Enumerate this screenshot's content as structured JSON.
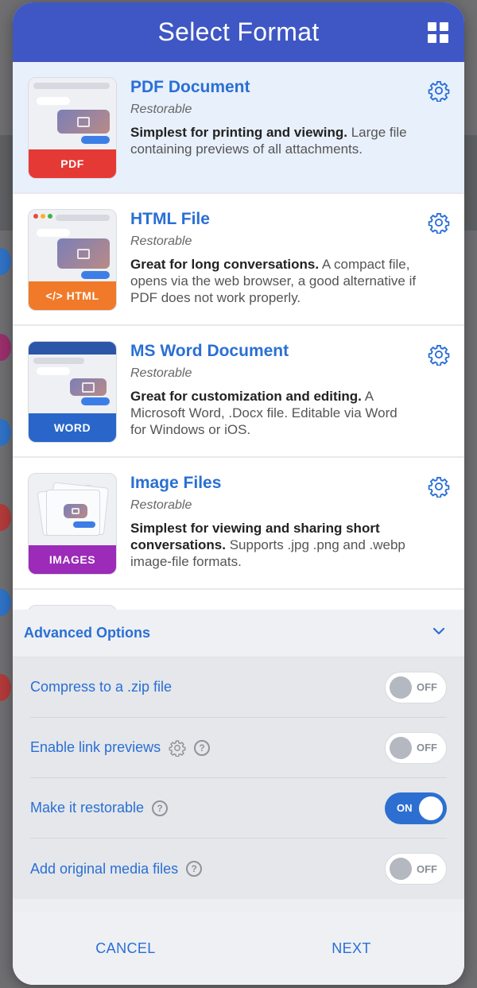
{
  "header": {
    "title": "Select Format",
    "icon": "grid-icon"
  },
  "formats": [
    {
      "title": "PDF Document",
      "subtitle": "Restorable",
      "desc_bold": "Simplest for printing and viewing.",
      "desc_rest": " Large file containing previews of all attachments.",
      "badge": "PDF",
      "badge_color": "#e53935",
      "selected": true
    },
    {
      "title": "HTML File",
      "subtitle": "Restorable",
      "desc_bold": "Great for long conversations.",
      "desc_rest": " A compact file, opens via the web browser, a good alternative if PDF does not work properly.",
      "badge": "</> HTML",
      "badge_color": "#f07a2a",
      "selected": false
    },
    {
      "title": "MS Word Document",
      "subtitle": "Restorable",
      "desc_bold": "Great for customization and editing.",
      "desc_rest": " A Microsoft Word, .Docx file. Editable via Word for Windows or iOS.",
      "badge": "WORD",
      "badge_color": "#2a66c9",
      "selected": false
    },
    {
      "title": "Image Files",
      "subtitle": "Restorable",
      "desc_bold": "Simplest for viewing and sharing short conversations.",
      "desc_rest": " Supports .jpg .png and .webp image-file formats.",
      "badge": "IMAGES",
      "badge_color": "#9b2bb8",
      "selected": false
    }
  ],
  "advanced": {
    "title": "Advanced Options",
    "options": [
      {
        "label": "Compress to a .zip file",
        "state": "OFF",
        "on": false,
        "gear": false,
        "help": false
      },
      {
        "label": "Enable link previews",
        "state": "OFF",
        "on": false,
        "gear": true,
        "help": true
      },
      {
        "label": "Make it restorable",
        "state": "ON",
        "on": true,
        "gear": false,
        "help": true
      },
      {
        "label": "Add original media files",
        "state": "OFF",
        "on": false,
        "gear": false,
        "help": true
      }
    ]
  },
  "footer": {
    "cancel": "CANCEL",
    "next": "NEXT"
  },
  "colors": {
    "header": "#3f57c4",
    "accent": "#2a6fd4",
    "selected_row": "#e8f0fb"
  }
}
